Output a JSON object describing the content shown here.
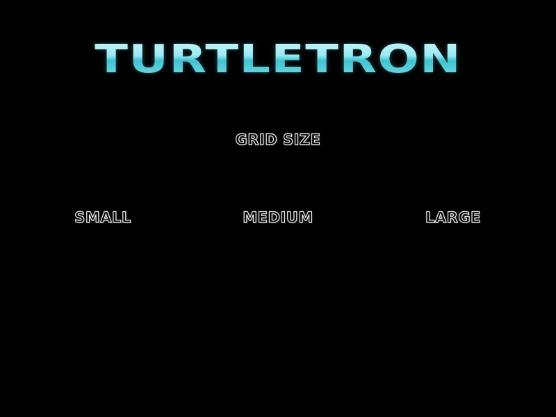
{
  "game": {
    "title": "TURTLETRON"
  },
  "menu": {
    "heading": "GRID SIZE",
    "options": [
      {
        "label": "SMALL"
      },
      {
        "label": "MEDIUM"
      },
      {
        "label": "LARGE"
      }
    ]
  },
  "colors": {
    "background": "#000000",
    "logo_cyan": "#8fe3ee",
    "text_outline": "#f2f2f2"
  }
}
